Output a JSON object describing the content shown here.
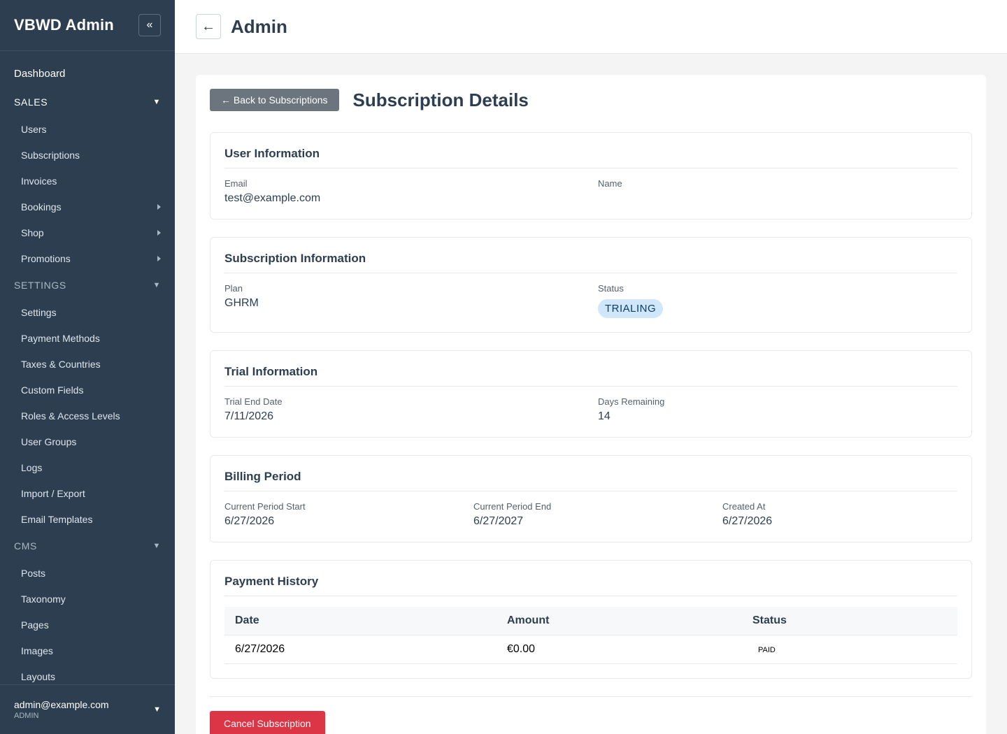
{
  "sidebar": {
    "title": "VBWD Admin",
    "collapse_icon": "«",
    "dashboard": "Dashboard",
    "sections": {
      "sales": "SALES",
      "settings": "SETTINGS",
      "cms": "CMS"
    },
    "sales_items": [
      "Users",
      "Subscriptions",
      "Invoices",
      "Bookings",
      "Shop",
      "Promotions"
    ],
    "settings_items": [
      "Settings",
      "Payment Methods",
      "Taxes & Countries",
      "Custom Fields",
      "Roles & Access Levels",
      "User Groups",
      "Logs",
      "Import / Export",
      "Email Templates"
    ],
    "cms_items": [
      "Posts",
      "Taxonomy",
      "Pages",
      "Images",
      "Layouts"
    ],
    "user_email": "admin@example.com",
    "user_role": "ADMIN"
  },
  "topbar": {
    "back_icon": "←",
    "title": "Admin"
  },
  "page": {
    "back_button": "← Back to Subscriptions",
    "title": "Subscription Details"
  },
  "user_info": {
    "heading": "User Information",
    "email_label": "Email",
    "email": "test@example.com",
    "name_label": "Name",
    "name": ""
  },
  "subscription_info": {
    "heading": "Subscription Information",
    "plan_label": "Plan",
    "plan": "GHRM",
    "status_label": "Status",
    "status": "TRIALING"
  },
  "trial_info": {
    "heading": "Trial Information",
    "end_label": "Trial End Date",
    "end": "7/11/2026",
    "days_label": "Days Remaining",
    "days": "14"
  },
  "billing": {
    "heading": "Billing Period",
    "start_label": "Current Period Start",
    "start": "6/27/2026",
    "end_label": "Current Period End",
    "end": "6/27/2027",
    "created_label": "Created At",
    "created": "6/27/2026"
  },
  "payments": {
    "heading": "Payment History",
    "columns": [
      "Date",
      "Amount",
      "Status"
    ],
    "rows": [
      {
        "date": "6/27/2026",
        "amount": "€0.00",
        "status": "PAID"
      }
    ]
  },
  "actions": {
    "cancel": "Cancel Subscription"
  },
  "colors": {
    "sidebar_bg": "#2c3e50",
    "status_badge_bg": "#cfe6fb",
    "cancel_button": "#dc3545",
    "back_button": "#6c757d"
  }
}
